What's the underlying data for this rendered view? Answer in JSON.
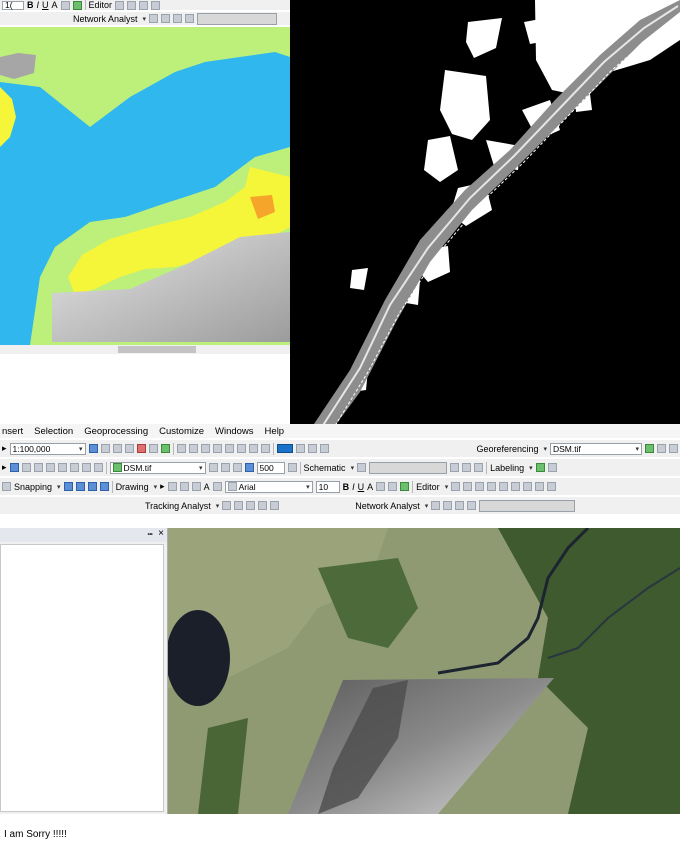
{
  "top_left_window": {
    "toolbar_row1": {
      "editor_label": "Editor",
      "size_value": "1("
    },
    "toolbar_row2": {
      "network_analyst_label": "Network Analyst"
    }
  },
  "main_window": {
    "menu": [
      "nsert",
      "Selection",
      "Geoprocessing",
      "Customize",
      "Windows",
      "Help"
    ],
    "scale": "1:100,000",
    "georeferencing_label": "Georeferencing",
    "georef_layer": "DSM.tif",
    "layer_dropdown": "DSM.tif",
    "resolution_value": "500",
    "schematic_label": "Schematic",
    "labeling_label": "Labeling",
    "snapping_label": "Snapping",
    "drawing_label": "Drawing",
    "font_name": "Arial",
    "font_size": "10",
    "editor_label": "Editor",
    "tracking_analyst_label": "Tracking Analyst",
    "network_analyst_label": "Network Analyst",
    "panel_pin": "⭺",
    "panel_close": "×"
  },
  "caption": "I am Sorry !!!!!",
  "colors": {
    "toolbar_bg": "#f0f0f0",
    "lime": "#bdf07a",
    "cyan": "#2fb7ee",
    "yellow": "#f5f53a"
  }
}
